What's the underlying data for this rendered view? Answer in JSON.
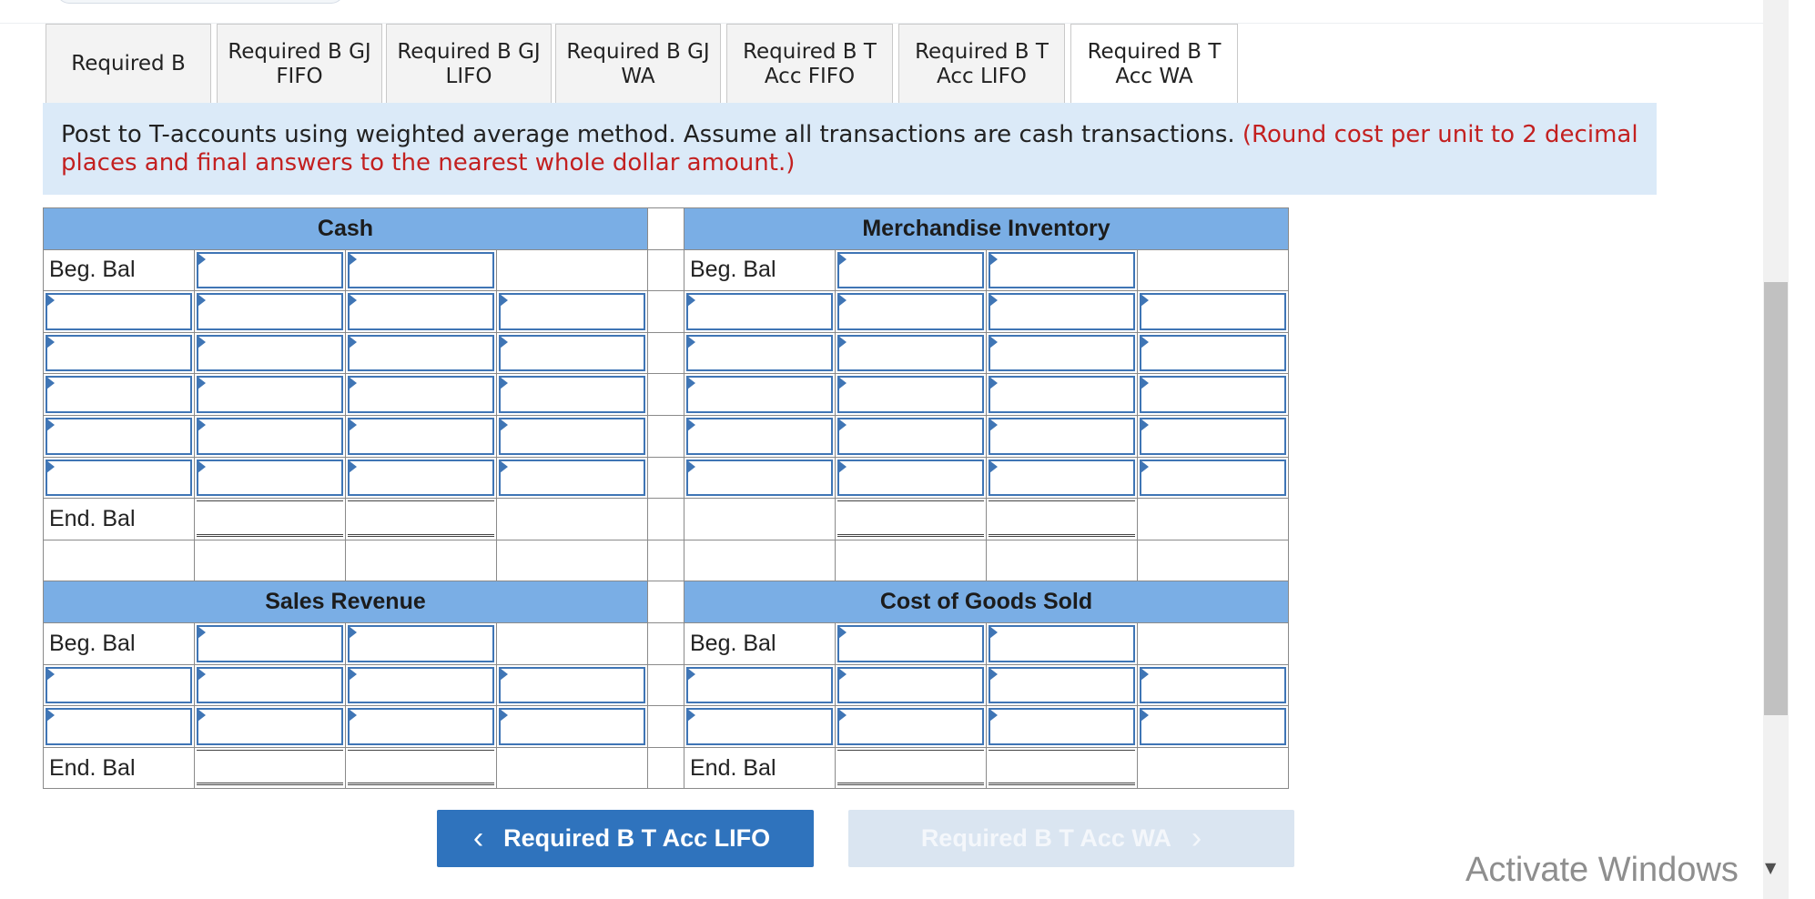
{
  "tabs": [
    {
      "label": "Required B"
    },
    {
      "label": "Required B GJ\nFIFO"
    },
    {
      "label": "Required B GJ\nLIFO"
    },
    {
      "label": "Required B GJ\nWA"
    },
    {
      "label": "Required B T\nAcc FIFO"
    },
    {
      "label": "Required B T\nAcc LIFO"
    },
    {
      "label": "Required B T\nAcc WA"
    }
  ],
  "active_tab": "Required B T Acc WA",
  "instructions": {
    "main": "Post to T-accounts using weighted average method. Assume all transactions are cash transactions.",
    "note": "(Round cost per unit to 2 decimal places and final answers to the nearest whole dollar amount.)"
  },
  "accounts": {
    "cash": {
      "title": "Cash"
    },
    "inventory": {
      "title": "Merchandise Inventory"
    },
    "sales": {
      "title": "Sales Revenue"
    },
    "cogs": {
      "title": "Cost of Goods Sold"
    }
  },
  "labels": {
    "beg_bal": "Beg. Bal",
    "end_bal": "End. Bal"
  },
  "nav": {
    "prev_label": "Required B T Acc LIFO",
    "next_label": "Required B T Acc WA",
    "prev_icon": "chevron-left-icon",
    "next_icon": "chevron-right-icon"
  },
  "watermark": "Activate Windows",
  "colors": {
    "header_fill": "#7aaee5",
    "instructions_bg": "#dbeaf8",
    "note_red": "#c32020",
    "input_border": "#3f75b5",
    "prev_button": "#2f73bd",
    "next_button_disabled": "#dae5f1"
  }
}
